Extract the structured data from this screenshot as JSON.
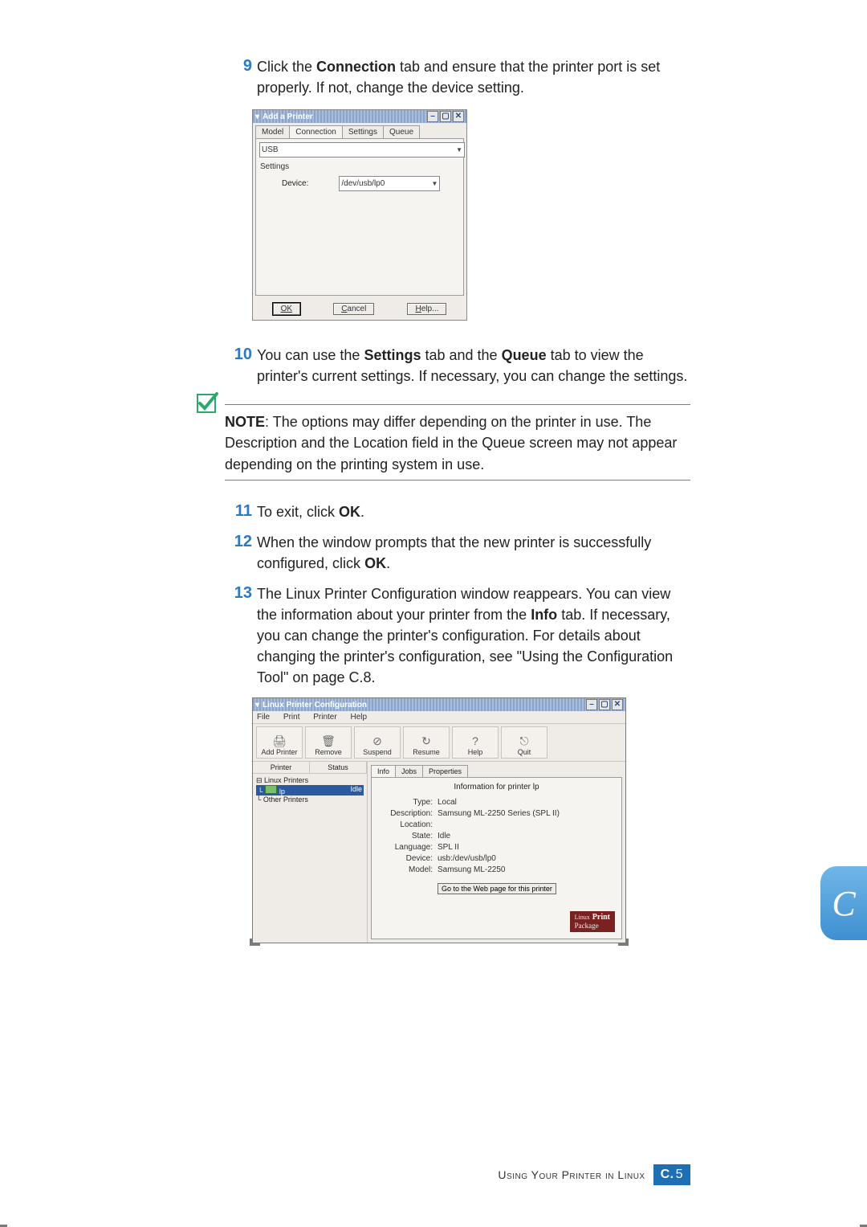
{
  "steps": {
    "s9": {
      "num": "9",
      "pre": "Click the ",
      "bold1": "Connection",
      "post1": " tab and ensure that the printer port is set properly. If not, change the device setting."
    },
    "s10": {
      "num": "10",
      "pre": "You can use the ",
      "bold1": "Settings",
      "mid": " tab and the ",
      "bold2": "Queue",
      "post": " tab to view the printer's current settings. If necessary, you can change the settings."
    },
    "s11": {
      "num": "11",
      "pre": "To exit, click ",
      "bold1": "OK",
      "post": "."
    },
    "s12": {
      "num": "12",
      "pre": "When the window prompts that the new printer is successfully configured, click ",
      "bold1": "OK",
      "post": "."
    },
    "s13": {
      "num": "13",
      "pre": "The Linux Printer Configuration window reappears. You can view the information about your printer from the ",
      "bold1": "Info",
      "post": " tab. If necessary, you can change the printer's configuration. For details about changing the printer's configuration, see \"Using the Configuration Tool\" on page C.8."
    }
  },
  "note": {
    "label": "NOTE",
    "body": ": The options may differ depending on the printer in use. The Description and the Location field in the Queue screen may not appear depending on the printing system in use."
  },
  "win1": {
    "title": "Add a Printer",
    "tabs": {
      "model": "Model",
      "connection": "Connection",
      "settings": "Settings",
      "queue": "Queue"
    },
    "usb": "USB",
    "settings_label": "Settings",
    "device_label": "Device:",
    "device_value": "/dev/usb/lp0",
    "buttons": {
      "ok": "OK",
      "cancel": "Cancel",
      "help": "Help..."
    }
  },
  "win2": {
    "title": "Linux Printer Configuration",
    "menus": {
      "file": "File",
      "print": "Print",
      "printer": "Printer",
      "help": "Help"
    },
    "tools": {
      "add": "Add Printer",
      "remove": "Remove",
      "suspend": "Suspend",
      "resume": "Resume",
      "thelp": "Help",
      "quit": "Quit"
    },
    "left": {
      "col_printer": "Printer",
      "col_status": "Status",
      "linux_printers": "Linux Printers",
      "lp_name": "lp",
      "lp_status": "Idle",
      "other_printers": "Other Printers"
    },
    "rtabs": {
      "info": "Info",
      "jobs": "Jobs",
      "props": "Properties"
    },
    "info_title": "Information for printer lp",
    "kv": {
      "type_k": "Type:",
      "type_v": "Local",
      "desc_k": "Description:",
      "desc_v": "Samsung ML-2250 Series (SPL II)",
      "loc_k": "Location:",
      "loc_v": "",
      "state_k": "State:",
      "state_v": "Idle",
      "lang_k": "Language:",
      "lang_v": "SPL II",
      "dev_k": "Device:",
      "dev_v": "usb:/dev/usb/lp0",
      "model_k": "Model:",
      "model_v": "Samsung ML-2250"
    },
    "go_btn": "Go to the Web page for this printer",
    "logo_small": "Linux",
    "logo_big1": "Print",
    "logo_big2": "Package"
  },
  "footer": {
    "text": "Using Your Printer in Linux",
    "badge_letter": "C.",
    "badge_num": "5"
  },
  "side_tab": "C"
}
